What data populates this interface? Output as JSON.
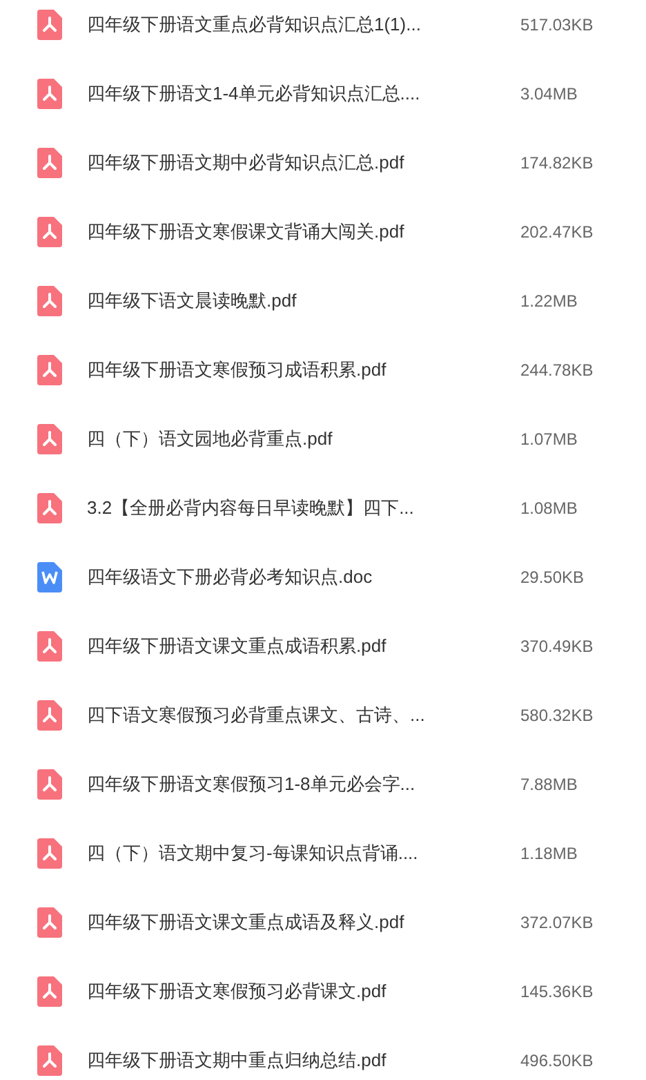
{
  "files": [
    {
      "kind": "pdf",
      "name": "四年级下册语文重点必背知识点汇总1(1)...",
      "size": "517.03KB"
    },
    {
      "kind": "pdf",
      "name": "四年级下册语文1-4单元必背知识点汇总....",
      "size": "3.04MB"
    },
    {
      "kind": "pdf",
      "name": "四年级下册语文期中必背知识点汇总.pdf",
      "size": "174.82KB"
    },
    {
      "kind": "pdf",
      "name": "四年级下册语文寒假课文背诵大闯关.pdf",
      "size": "202.47KB"
    },
    {
      "kind": "pdf",
      "name": "四年级下语文晨读晚默.pdf",
      "size": "1.22MB"
    },
    {
      "kind": "pdf",
      "name": "四年级下册语文寒假预习成语积累.pdf",
      "size": "244.78KB"
    },
    {
      "kind": "pdf",
      "name": "四（下）语文园地必背重点.pdf",
      "size": "1.07MB"
    },
    {
      "kind": "pdf",
      "name": "3.2【全册必背内容每日早读晚默】四下...",
      "size": "1.08MB"
    },
    {
      "kind": "doc",
      "name": "四年级语文下册必背必考知识点.doc",
      "size": "29.50KB"
    },
    {
      "kind": "pdf",
      "name": "四年级下册语文课文重点成语积累.pdf",
      "size": "370.49KB"
    },
    {
      "kind": "pdf",
      "name": "四下语文寒假预习必背重点课文、古诗、...",
      "size": "580.32KB"
    },
    {
      "kind": "pdf",
      "name": "四年级下册语文寒假预习1-8单元必会字...",
      "size": "7.88MB"
    },
    {
      "kind": "pdf",
      "name": "四（下）语文期中复习-每课知识点背诵....",
      "size": "1.18MB"
    },
    {
      "kind": "pdf",
      "name": "四年级下册语文课文重点成语及释义.pdf",
      "size": "372.07KB"
    },
    {
      "kind": "pdf",
      "name": "四年级下册语文寒假预习必背课文.pdf",
      "size": "145.36KB"
    },
    {
      "kind": "pdf",
      "name": "四年级下册语文期中重点归纳总结.pdf",
      "size": "496.50KB"
    }
  ]
}
